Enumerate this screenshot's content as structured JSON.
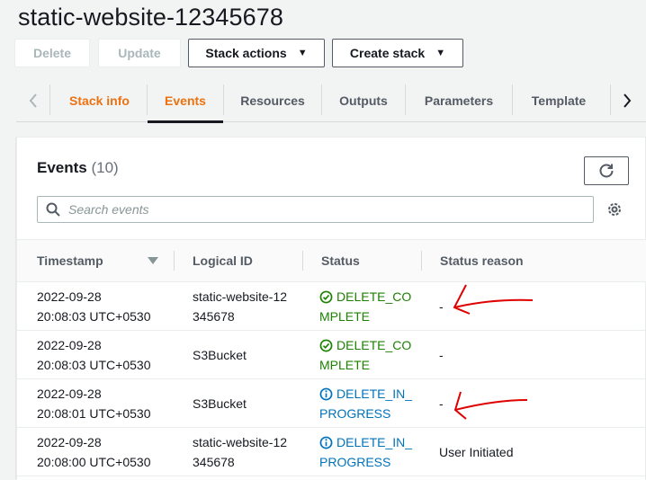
{
  "page": {
    "title": "static-website-12345678"
  },
  "toolbar": {
    "delete_label": "Delete",
    "update_label": "Update",
    "stack_actions_label": "Stack actions",
    "create_stack_label": "Create stack"
  },
  "tabs": [
    {
      "label": "Stack info"
    },
    {
      "label": "Events"
    },
    {
      "label": "Resources"
    },
    {
      "label": "Outputs"
    },
    {
      "label": "Parameters"
    },
    {
      "label": "Template"
    }
  ],
  "events": {
    "title": "Events",
    "count": "(10)",
    "search_placeholder": "Search events",
    "columns": [
      "Timestamp",
      "Logical ID",
      "Status",
      "Status reason"
    ],
    "rows": [
      {
        "date": "2022-09-28",
        "time": "20:08:03 UTC+0530",
        "logical_id": "static-website-12345678",
        "status": "DELETE_COMPLETE",
        "status_type": "success",
        "reason": "-"
      },
      {
        "date": "2022-09-28",
        "time": "20:08:03 UTC+0530",
        "logical_id": "S3Bucket",
        "status": "DELETE_COMPLETE",
        "status_type": "success",
        "reason": "-"
      },
      {
        "date": "2022-09-28",
        "time": "20:08:01 UTC+0530",
        "logical_id": "S3Bucket",
        "status": "DELETE_IN_PROGRESS",
        "status_type": "info",
        "reason": "-"
      },
      {
        "date": "2022-09-28",
        "time": "20:08:00 UTC+0530",
        "logical_id": "static-website-12345678",
        "status": "DELETE_IN_PROGRESS",
        "status_type": "info",
        "reason": "User Initiated"
      }
    ]
  },
  "icons": {
    "refresh": "refresh-icon",
    "search": "search-icon",
    "settings": "gear-icon",
    "success": "check-circle-icon",
    "info": "info-circle-icon"
  },
  "colors": {
    "accent": "#ec7211",
    "success": "#1d8102",
    "info": "#0073bb",
    "annotation": "#e00000"
  }
}
